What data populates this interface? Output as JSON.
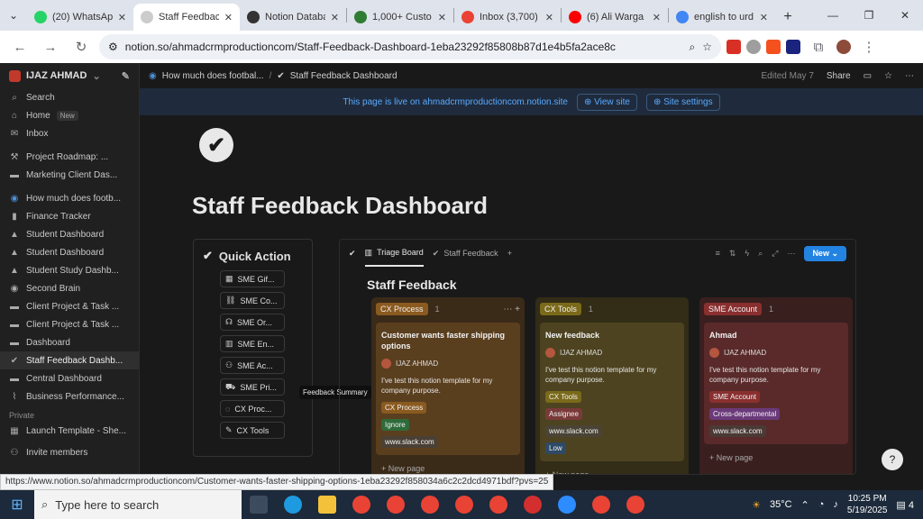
{
  "browser": {
    "tabs": [
      {
        "title": "(20) WhatsApp",
        "color": "#25d366"
      },
      {
        "title": "Staff Feedback",
        "color": "#cccccc",
        "active": true
      },
      {
        "title": "Notion Databa",
        "color": "#333333"
      },
      {
        "title": "1,000+ Custo",
        "color": "#2e7d32"
      },
      {
        "title": "Inbox (3,700)",
        "color": "#ea4335"
      },
      {
        "title": "(6) Ali Warga",
        "color": "#ff0000"
      },
      {
        "title": "english to urd",
        "color": "#4285f4"
      }
    ],
    "url": "notion.so/ahmadcrmproductioncom/Staff-Feedback-Dashboard-1eba23292f85808b87d1e4b5fa2ace8c"
  },
  "sidebar": {
    "workspace": "IJAZ AHMAD",
    "nav": [
      {
        "icon": "⌕",
        "label": "Search"
      },
      {
        "icon": "⌂",
        "label": "Home",
        "badge": "New"
      },
      {
        "icon": "✉",
        "label": "Inbox"
      }
    ],
    "pages": [
      {
        "icon": "⚒",
        "label": "Project Roadmap: ..."
      },
      {
        "icon": "▬",
        "label": "Marketing Client Das..."
      }
    ],
    "teamspace": "How much does footb...",
    "team_pages": [
      {
        "icon": "▮",
        "label": "Finance Tracker"
      },
      {
        "icon": "▲",
        "label": "Student Dashboard"
      },
      {
        "icon": "▲",
        "label": "Student Dashboard"
      },
      {
        "icon": "▲",
        "label": "Student Study Dashb..."
      },
      {
        "icon": "◉",
        "label": "Second Brain"
      },
      {
        "icon": "▬",
        "label": "Client Project & Task ..."
      },
      {
        "icon": "▬",
        "label": "Client Project & Task ..."
      },
      {
        "icon": "▬",
        "label": "Dashboard"
      },
      {
        "icon": "✔",
        "label": "Staff Feedback Dashb..."
      },
      {
        "icon": "▬",
        "label": "Central Dashboard"
      },
      {
        "icon": "⌇",
        "label": "Business Performance..."
      }
    ],
    "private_label": "Private",
    "private_pages": [
      {
        "icon": "▦",
        "label": "Launch Template - She..."
      }
    ],
    "invite": "Invite members"
  },
  "topbar": {
    "crumb1": "How much does footbal...",
    "sep": "/",
    "crumb2": "Staff Feedback Dashboard",
    "edited": "Edited May 7",
    "share": "Share"
  },
  "banner": {
    "text": "This page is live on ahmadcrmproductioncom.notion.site",
    "view_site": "View site",
    "site_settings": "Site settings"
  },
  "page": {
    "title": "Staff Feedback Dashboard"
  },
  "quick_action": {
    "title": "Quick Action",
    "buttons": [
      {
        "icon": "▦",
        "label": "SME Gif..."
      },
      {
        "icon": "⛓",
        "label": "SME Co..."
      },
      {
        "icon": "☊",
        "label": "SME Or..."
      },
      {
        "icon": "▥",
        "label": "SME En..."
      },
      {
        "icon": "⚇",
        "label": "SME Ac..."
      },
      {
        "icon": "⛟",
        "label": "SME Pri..."
      },
      {
        "icon": "◌",
        "label": "CX Proc..."
      },
      {
        "icon": "✎",
        "label": "CX Tools"
      }
    ],
    "tooltip": "Feedback Summary"
  },
  "database": {
    "tab_board": "Triage Board",
    "tab_feedback": "Staff Feedback",
    "new_button": "New",
    "title": "Staff Feedback",
    "columns": [
      {
        "name": "CX Process",
        "count": "1",
        "pill": "#8a5a1f",
        "bg": "#3a2a18",
        "card_bg": "#5a3f1f",
        "card": {
          "title": "Customer wants faster shipping options",
          "person": "IJAZ AHMAD",
          "desc": "I've test this notion template for my company purpose.",
          "tags": [
            {
              "text": "CX Process",
              "bg": "#8a5a1f"
            },
            {
              "text": "Ignore",
              "bg": "#2f6b3a"
            },
            {
              "text": "www.slack.com",
              "bg": "#4a4036"
            }
          ]
        }
      },
      {
        "name": "CX Tools",
        "count": "1",
        "pill": "#7a6a1a",
        "bg": "#332c16",
        "card_bg": "#4d4320",
        "card": {
          "title": "New feedback",
          "person": "IJAZ AHMAD",
          "desc": "I've test this notion template for my company purpose.",
          "tags": [
            {
              "text": "CX Tools",
              "bg": "#7a6a1a"
            },
            {
              "text": "Assignee",
              "bg": "#7a3a3a"
            },
            {
              "text": "www.slack.com",
              "bg": "#4a4436"
            },
            {
              "text": "Low",
              "bg": "#2d4a66"
            }
          ]
        }
      },
      {
        "name": "SME Account",
        "count": "1",
        "pill": "#8a2f2f",
        "bg": "#3a1f1f",
        "card_bg": "#5a2a2a",
        "card": {
          "title": "Ahmad",
          "person": "IJAZ AHMAD",
          "desc": "I've test this notion template for my company purpose.",
          "tags": [
            {
              "text": "SME Account",
              "bg": "#8a2f2f"
            },
            {
              "text": "Cross-departmental",
              "bg": "#6a3a7a"
            },
            {
              "text": "www.slack.com",
              "bg": "#4a3a36"
            }
          ]
        }
      }
    ],
    "new_page": "New page"
  },
  "status_url": "https://www.notion.so/ahmadcrmproductioncom/Customer-wants-faster-shipping-options-1eba23292f858034a6c2c2dcd4971bdf?pvs=25",
  "taskbar": {
    "search_placeholder": "Type here to search",
    "temperature": "35°C",
    "time": "10:25 PM",
    "date": "5/19/2025",
    "notifications": "4"
  }
}
